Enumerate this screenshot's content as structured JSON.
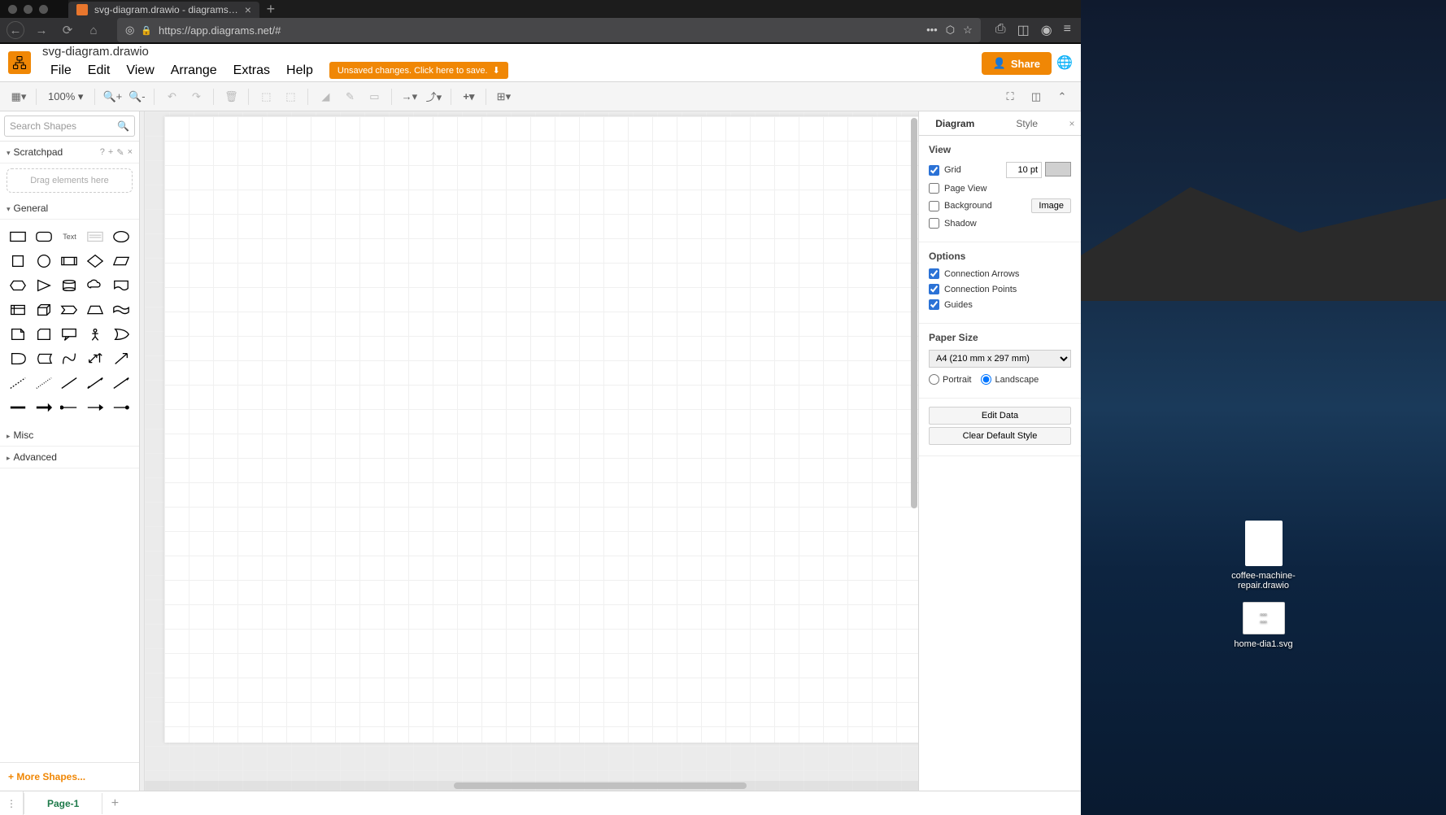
{
  "browser": {
    "tab_title": "svg-diagram.drawio - diagrams…",
    "url": "https://app.diagrams.net/#"
  },
  "header": {
    "doc_title": "svg-diagram.drawio",
    "share_label": "Share"
  },
  "menu": {
    "items": [
      "File",
      "Edit",
      "View",
      "Arrange",
      "Extras",
      "Help"
    ],
    "save_banner": "Unsaved changes. Click here to save."
  },
  "toolbar": {
    "zoom": "100%"
  },
  "left": {
    "search_placeholder": "Search Shapes",
    "scratchpad_label": "Scratchpad",
    "scratch_drop": "Drag elements here",
    "general_label": "General",
    "misc_label": "Misc",
    "advanced_label": "Advanced",
    "more_shapes": "More Shapes..."
  },
  "right": {
    "tab_diagram": "Diagram",
    "tab_style": "Style",
    "view_heading": "View",
    "grid_label": "Grid",
    "grid_value": "10 pt",
    "pageview_label": "Page View",
    "background_label": "Background",
    "image_btn": "Image",
    "shadow_label": "Shadow",
    "options_heading": "Options",
    "conn_arrows": "Connection Arrows",
    "conn_points": "Connection Points",
    "guides": "Guides",
    "papersize_heading": "Paper Size",
    "papersize_value": "A4 (210 mm x 297 mm)",
    "portrait": "Portrait",
    "landscape": "Landscape",
    "edit_data": "Edit Data",
    "clear_default": "Clear Default Style"
  },
  "footer": {
    "page_label": "Page-1"
  },
  "desktop": {
    "file1": "coffee-machine-repair.drawio",
    "file2": "home-dia1.svg"
  }
}
